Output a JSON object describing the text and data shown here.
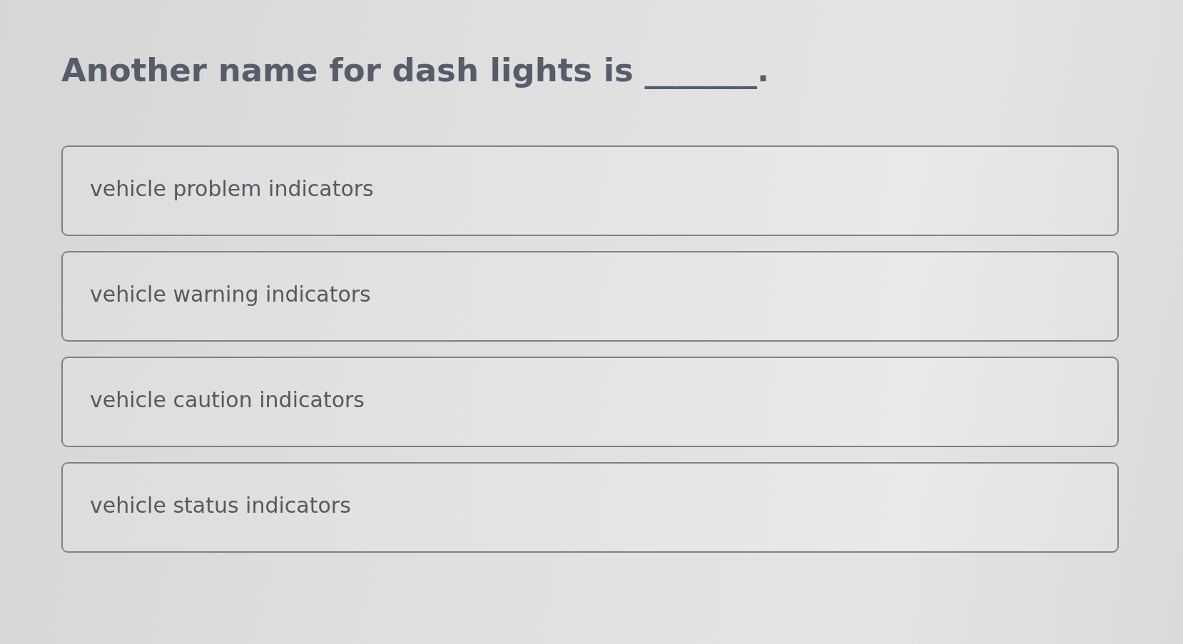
{
  "question": {
    "text": "Another name for dash lights is _______."
  },
  "options": [
    {
      "label": "vehicle problem indicators",
      "selected": false
    },
    {
      "label": "vehicle warning indicators",
      "selected": false
    },
    {
      "label": "vehicle caution indicators",
      "selected": false
    },
    {
      "label": "vehicle status indicators",
      "selected": false
    }
  ]
}
